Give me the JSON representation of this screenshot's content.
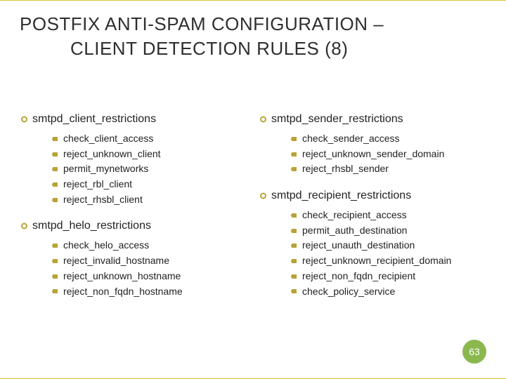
{
  "title_line1": "POSTFIX ANTI-SPAM CONFIGURATION –",
  "title_line2": "CLIENT DETECTION RULES (8)",
  "left": {
    "sections": [
      {
        "heading": "smtpd_client_restrictions",
        "items": [
          "check_client_access",
          "reject_unknown_client",
          "permit_mynetworks",
          "reject_rbl_client",
          "reject_rhsbl_client"
        ]
      },
      {
        "heading": "smtpd_helo_restrictions",
        "items": [
          "check_helo_access",
          "reject_invalid_hostname",
          "reject_unknown_hostname",
          "reject_non_fqdn_hostname"
        ]
      }
    ]
  },
  "right": {
    "sections": [
      {
        "heading": "smtpd_sender_restrictions",
        "items": [
          "check_sender_access",
          "reject_unknown_sender_domain",
          "reject_rhsbl_sender"
        ]
      },
      {
        "heading": "smtpd_recipient_restrictions",
        "items": [
          "check_recipient_access",
          "permit_auth_destination",
          "reject_unauth_destination",
          "reject_unknown_recipient_domain",
          "reject_non_fqdn_recipient",
          "check_policy_service"
        ]
      }
    ]
  },
  "page_number": "63"
}
